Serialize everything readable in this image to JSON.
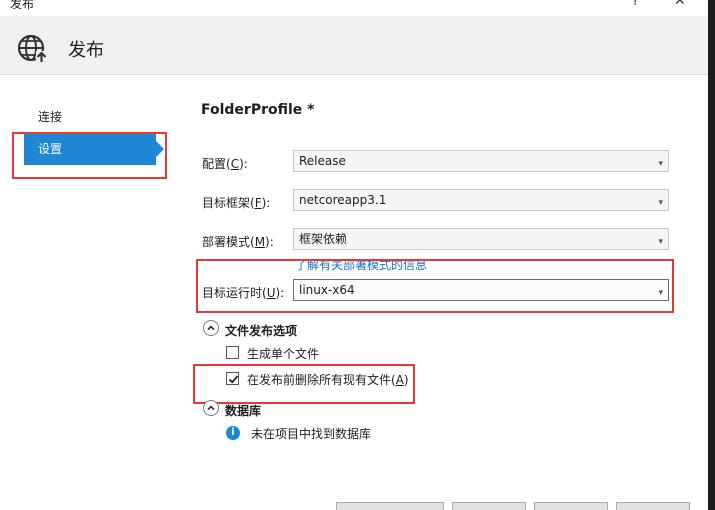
{
  "window": {
    "title": "发布",
    "help_glyph": "?",
    "close_glyph": "✕"
  },
  "header": {
    "title": "发布",
    "icon": "globe-publish-icon"
  },
  "sidebar": {
    "items": [
      {
        "label": "连接",
        "selected": false
      },
      {
        "label": "设置",
        "selected": true
      }
    ]
  },
  "profile": {
    "title": "FolderProfile *"
  },
  "fields": {
    "configuration": {
      "label": "配置(C):",
      "label_pre": "配置(",
      "accel": "C",
      "label_post": "):",
      "value": "Release"
    },
    "target_framework": {
      "label": "目标框架(F):",
      "label_pre": "目标框架(",
      "accel": "F",
      "label_post": "):",
      "value": "netcoreapp3.1"
    },
    "deployment_mode": {
      "label": "部署模式(M):",
      "label_pre": "部署模式(",
      "accel": "M",
      "label_post": "):",
      "value": "框架依赖"
    },
    "deployment_link": "了解有关部署模式的信息",
    "target_runtime": {
      "label": "目标运行时(U):",
      "label_pre": "目标运行时(",
      "accel": "U",
      "label_post": "):",
      "value": "linux-x64"
    }
  },
  "file_publish_options": {
    "title": "文件发布选项",
    "single_file": {
      "label": "生成单个文件",
      "checked": false
    },
    "delete_existing": {
      "label": "在发布前删除所有现有文件(A)",
      "label_pre": "在发布前删除所有现有文件(",
      "accel": "A",
      "label_post": ")",
      "checked": true
    }
  },
  "databases": {
    "title": "数据库",
    "info_text": "未在项目中找到数据库",
    "info_glyph": "i"
  },
  "colors": {
    "accent": "#1e88d4",
    "highlight": "#e53935",
    "link": "#1a73c7"
  }
}
